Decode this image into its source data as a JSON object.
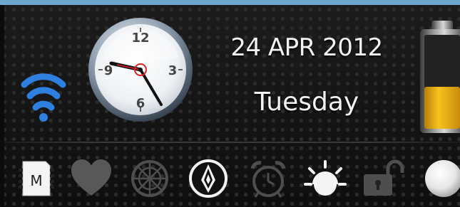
{
  "widget": {
    "date": "24 APR 2012",
    "day": "Tuesday",
    "clock": {
      "numerals": [
        "12",
        "3",
        "6",
        "9"
      ]
    },
    "battery": {
      "level_fraction": 0.45,
      "fill_color": "#f2b417"
    },
    "wifi": {
      "color": "#2f7fe0"
    }
  },
  "toolbar": {
    "items": [
      {
        "icon": "sd-card-icon",
        "label": "M",
        "active": true
      },
      {
        "icon": "heart-icon",
        "active": false
      },
      {
        "icon": "sync-icon",
        "active": false
      },
      {
        "icon": "compass-icon",
        "active": true
      },
      {
        "icon": "alarm-clock-icon",
        "active": false
      },
      {
        "icon": "brightness-icon",
        "active": true
      },
      {
        "icon": "lock-icon",
        "active": false
      },
      {
        "icon": "round-button-icon",
        "active": true
      }
    ]
  }
}
